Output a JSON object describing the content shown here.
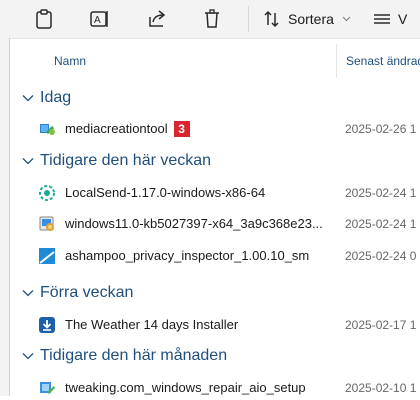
{
  "toolbar": {
    "sort_label": "Sortera",
    "icons": [
      "clipboard-icon",
      "rename-icon",
      "share-icon",
      "delete-icon",
      "sort-icon",
      "view-icon"
    ]
  },
  "columns": {
    "name": "Namn",
    "date": "Senast ändrad"
  },
  "groups": [
    {
      "label": "Idag",
      "items": [
        {
          "name": "mediacreationtool",
          "date": "2025-02-26 1",
          "badge": "3",
          "icon": "media-creation-tool-icon"
        }
      ]
    },
    {
      "label": "Tidigare den här veckan",
      "items": [
        {
          "name": "LocalSend-1.17.0-windows-x86-64",
          "date": "2025-02-24 1",
          "icon": "localsend-icon"
        },
        {
          "name": "windows11.0-kb5027397-x64_3a9c368e23...",
          "date": "2025-02-24 1",
          "icon": "windows-update-package-icon"
        },
        {
          "name": "ashampoo_privacy_inspector_1.00.10_sm",
          "date": "2025-02-24 0",
          "icon": "ashampoo-icon"
        }
      ]
    },
    {
      "label": "Förra veckan",
      "items": [
        {
          "name": "The Weather 14 days Installer",
          "date": "2025-02-17 1",
          "icon": "installer-download-icon"
        }
      ]
    },
    {
      "label": "Tidigare den här månaden",
      "items": [
        {
          "name": "tweaking.com_windows_repair_aio_setup",
          "date": "2025-02-10 1",
          "icon": "setup-installer-icon"
        }
      ]
    }
  ],
  "colors": {
    "group_header": "#1f4f7d",
    "badge": "#d8252e",
    "toolbar_bg": "#f3f3f3"
  }
}
